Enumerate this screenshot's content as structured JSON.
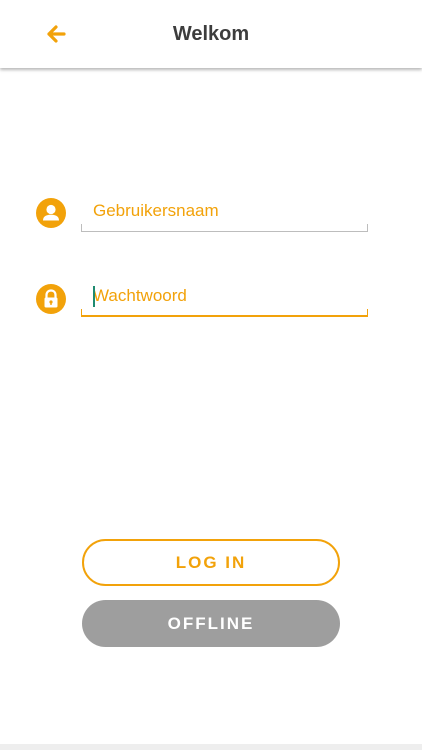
{
  "header": {
    "title": "Welkom",
    "back_icon": "arrow-left-icon"
  },
  "form": {
    "username": {
      "icon": "user-icon",
      "placeholder": "Gebruikersnaam",
      "value": ""
    },
    "password": {
      "icon": "lock-icon",
      "placeholder": "Wachtwoord",
      "value": "",
      "focused": true
    }
  },
  "buttons": {
    "login_label": "LOG IN",
    "offline_label": "OFFLINE"
  },
  "colors": {
    "accent": "#f2a20a",
    "title_text": "#3d3d3d",
    "offline_button": "#9e9e9e",
    "inactive_underline": "#bdbdbd"
  }
}
